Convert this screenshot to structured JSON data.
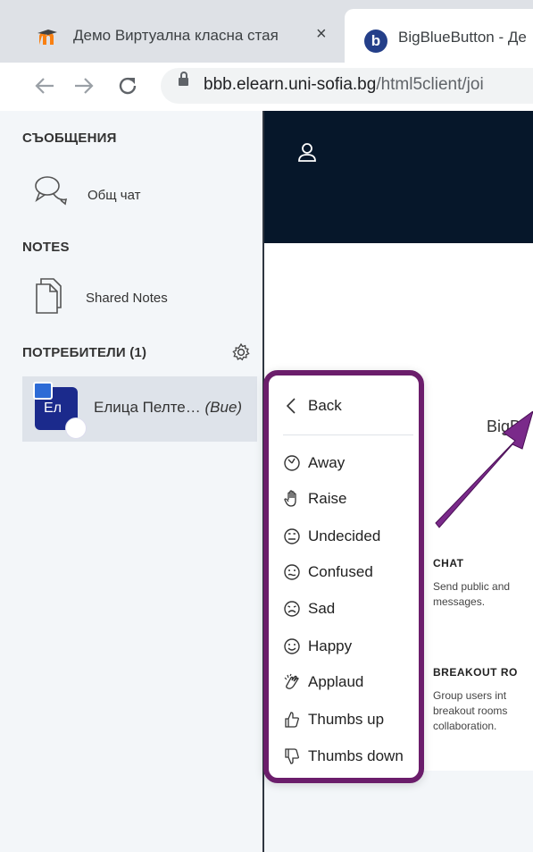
{
  "browser": {
    "tabs": [
      {
        "title": "Демо Виртуална класна стая",
        "close": "×",
        "favicon": "moodle-icon"
      },
      {
        "title": "BigBlueButton - Де",
        "favicon": "bigbluebutton-icon",
        "favicon_letter": "b"
      }
    ],
    "url_host": "bbb.elearn.uni-sofia.bg",
    "url_path": "/html5client/joi"
  },
  "sidebar": {
    "messages_title": "СЪОБЩЕНИЯ",
    "public_chat": "Общ чат",
    "notes_title": "NOTES",
    "shared_notes": "Shared Notes",
    "users_title": "ПОТРЕБИТЕЛИ (1)",
    "user": {
      "initials": "Ел",
      "name": "Елица Пелте…",
      "you": "(Вие)"
    }
  },
  "main": {
    "welcome_partial": "BigBl",
    "cards": [
      {
        "heading": "CHAT",
        "text_lines": [
          "Send public and",
          "messages."
        ]
      },
      {
        "heading": "BREAKOUT RO",
        "text_lines": [
          "Group users int",
          "breakout rooms",
          "collaboration."
        ]
      }
    ]
  },
  "status_menu": {
    "back": "Back",
    "items": [
      {
        "label": "Away",
        "icon": "clock-icon"
      },
      {
        "label": "Raise",
        "icon": "raise-hand-icon"
      },
      {
        "label": "Undecided",
        "icon": "undecided-face-icon"
      },
      {
        "label": "Confused",
        "icon": "confused-face-icon"
      },
      {
        "label": "Sad",
        "icon": "sad-face-icon"
      },
      {
        "label": "Happy",
        "icon": "happy-face-icon"
      },
      {
        "label": "Applaud",
        "icon": "applaud-icon"
      },
      {
        "label": "Thumbs up",
        "icon": "thumbs-up-icon"
      },
      {
        "label": "Thumbs down",
        "icon": "thumbs-down-icon"
      }
    ]
  },
  "colors": {
    "annotation": "#6b1d6b",
    "topbar": "#06172a",
    "avatar": "#1b2a8c"
  }
}
